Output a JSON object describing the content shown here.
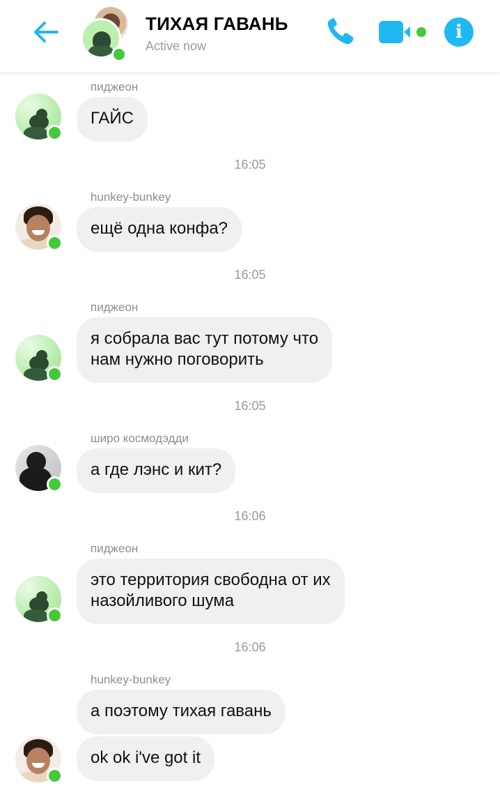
{
  "header": {
    "title": "ТИХАЯ ГАВАНЬ",
    "status": "Active now",
    "accent_color": "#1fb8f3",
    "online_color": "#45c93a",
    "icons": [
      "back-arrow-icon",
      "phone-icon",
      "video-camera-icon",
      "info-icon"
    ],
    "info_glyph": "i"
  },
  "messages": [
    {
      "sender": "пиджеон",
      "text": "ГАЙС",
      "time": "16:05",
      "avatar": "green-photo"
    },
    {
      "sender": "hunkey-bunkey",
      "text": "ещё одна конфа?",
      "time": "16:05",
      "avatar": "smiling-guy-photo"
    },
    {
      "sender": "пиджеон",
      "text_line1": "я собрала вас тут потому что",
      "text_line2": "нам нужно поговорить",
      "time": "16:05",
      "avatar": "green-photo"
    },
    {
      "sender": "широ космодэдди",
      "text": "а где лэнс и кит?",
      "time": "16:06",
      "avatar": "dark-figure-photo"
    },
    {
      "sender": "пиджеон",
      "text_line1": "это территория свободна от их",
      "text_line2": "назойливого шума",
      "time": "16:06",
      "avatar": "green-photo"
    },
    {
      "sender": "hunkey-bunkey",
      "text": "а поэтому тихая гавань",
      "text2": "ok ok i've got it",
      "avatar": "smiling-guy-photo"
    }
  ]
}
